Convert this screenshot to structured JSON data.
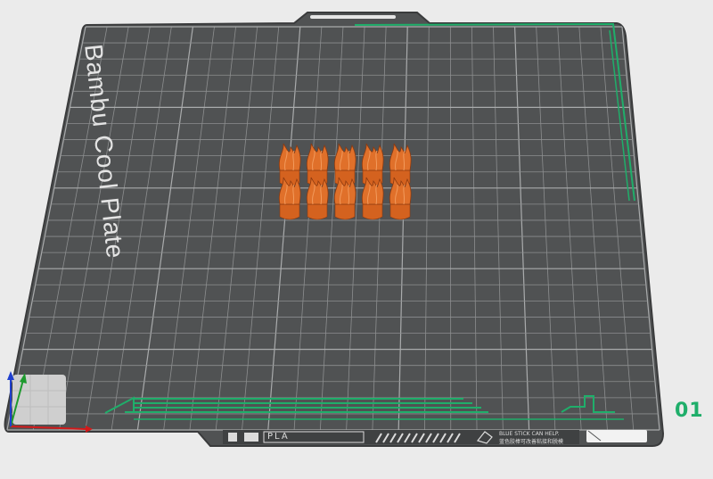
{
  "plate": {
    "name": "Bambu Cool Plate",
    "filament_label": "PLA",
    "hint_line1": "BLUE STICK CAN HELP.",
    "hint_line2": "蓝色胶棒可改善粘接和脱模",
    "number": "01"
  },
  "colors": {
    "plate_fill": "#505253",
    "plate_edge": "#3a3b3c",
    "grid": "#8c8e8f",
    "grid_major": "#a9abac",
    "accent_green": "#1fae6a",
    "model_orange": "#d4621f",
    "axis_x": "#d21a1a",
    "axis_y": "#1e9a2e",
    "axis_z": "#1f3fcf"
  },
  "models": {
    "rows": 2,
    "columns": 5,
    "label": "flame-shaped objects"
  }
}
